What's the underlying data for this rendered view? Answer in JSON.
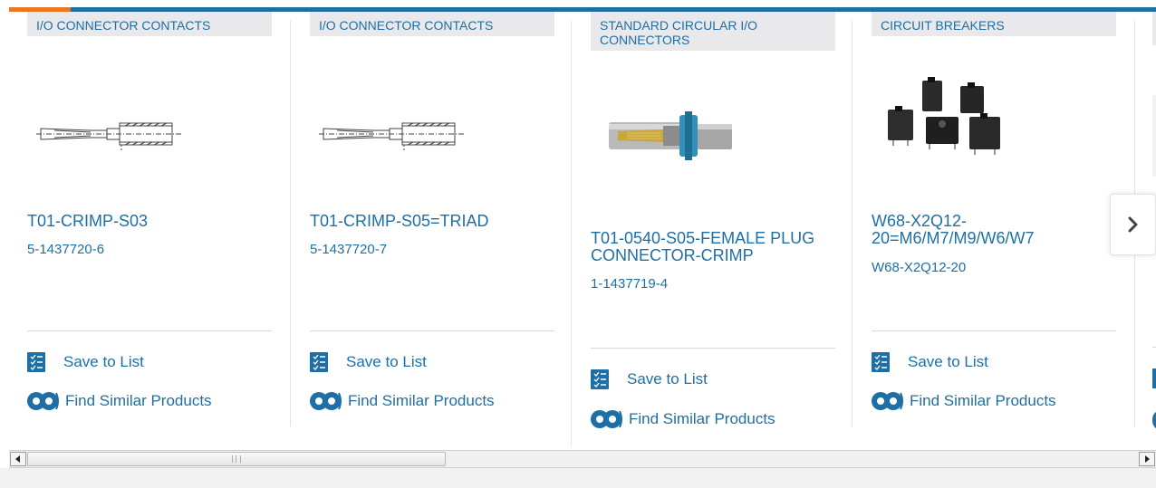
{
  "cards": [
    {
      "category": "I/O CONNECTOR CONTACTS",
      "name": "T01-CRIMP-S03",
      "part_number": "5-1437720-6",
      "image": "crimp-contact-drawing"
    },
    {
      "category": "I/O CONNECTOR CONTACTS",
      "name": "T01-CRIMP-S05=TRIAD",
      "part_number": "5-1437720-7",
      "image": "crimp-contact-drawing"
    },
    {
      "category": "STANDARD CIRCULAR I/O CONNECTORS",
      "name": "T01-0540-S05-FEMALE PLUG CONNECTOR-CRIMP",
      "part_number": "1-1437719-4",
      "image": "circular-connector-photo"
    },
    {
      "category": "CIRCUIT BREAKERS",
      "name": "W68-X2Q12-20=M6/M7/M9/W6/W7",
      "part_number": "W68-X2Q12-20",
      "image": "circuit-breakers-photo"
    }
  ],
  "actions": {
    "save_to_list": "Save to List",
    "find_similar": "Find Similar Products"
  },
  "icons": {
    "save": "checklist-icon",
    "similar": "binoculars-icon",
    "next": "chevron-right-icon",
    "scroll_left": "arrow-left-icon",
    "scroll_right": "arrow-right-icon"
  },
  "colors": {
    "link": "#1d6fa5",
    "accent": "#e87722",
    "tag_bg": "#e9e9eb"
  }
}
